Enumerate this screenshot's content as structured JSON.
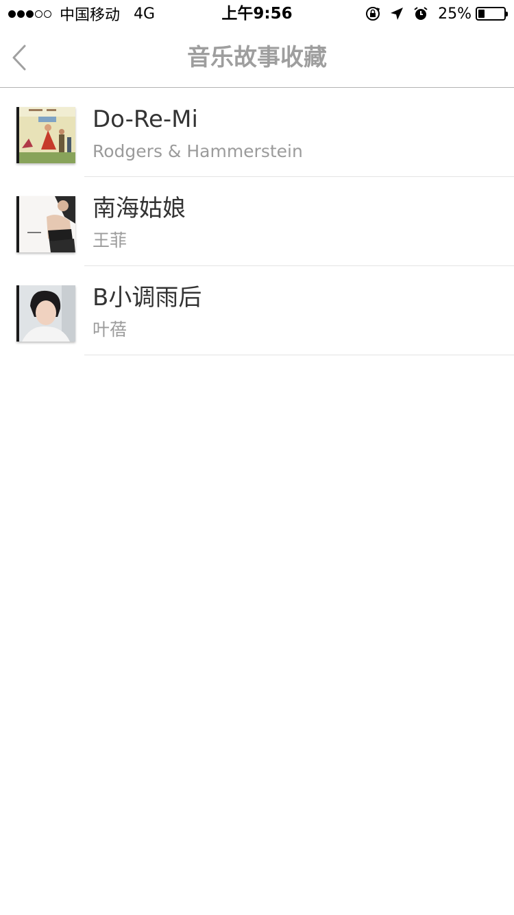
{
  "status_bar": {
    "signal_filled": 3,
    "signal_total": 5,
    "carrier": "中国移动",
    "network": "4G",
    "time": "上午9:56",
    "icons": [
      "orientation-lock-icon",
      "location-arrow-icon",
      "alarm-icon"
    ],
    "battery_percent": "25%",
    "battery_level": 0.25
  },
  "nav": {
    "back_icon": "chevron-left-icon",
    "title": "音乐故事收藏"
  },
  "songs": [
    {
      "title": "Do-Re-Mi",
      "artist": "Rodgers & Hammerstein",
      "cover_icon": "album-cover-sound-of-music"
    },
    {
      "title": "南海姑娘",
      "artist": "王菲",
      "cover_icon": "album-cover-faye-wong"
    },
    {
      "title": "B小调雨后",
      "artist": "叶蓓",
      "cover_icon": "album-cover-ye-bei"
    }
  ],
  "colors": {
    "title_text": "#333333",
    "subtitle_text": "#9b9b9b",
    "nav_title": "#9e9e9e",
    "divider": "#e3e3e3"
  }
}
